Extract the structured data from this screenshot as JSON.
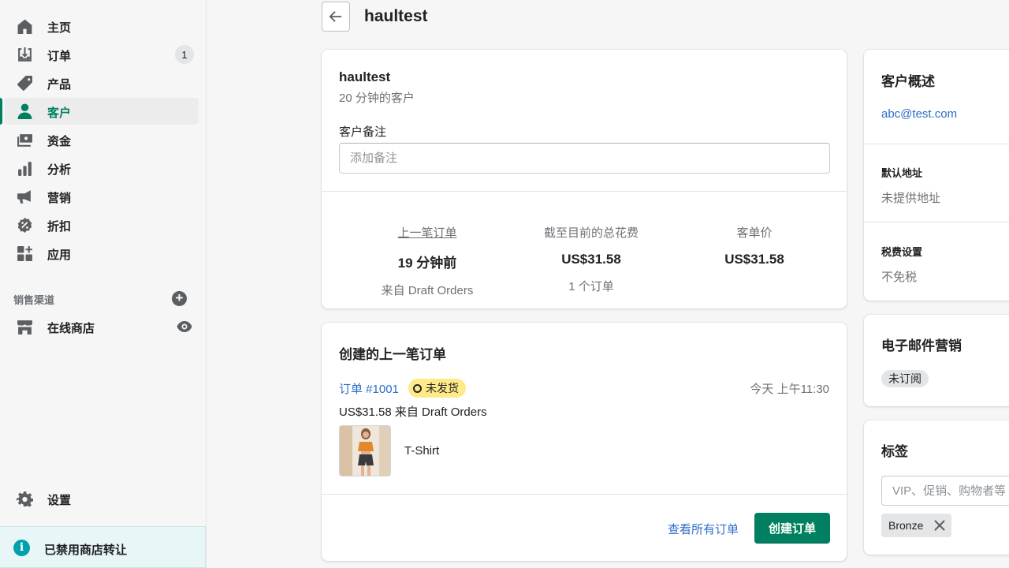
{
  "nav": {
    "items": [
      {
        "label": "主页",
        "icon": "home-icon"
      },
      {
        "label": "订单",
        "icon": "orders-icon",
        "badge": "1"
      },
      {
        "label": "产品",
        "icon": "tag-icon"
      },
      {
        "label": "客户",
        "icon": "person-icon",
        "active": true
      },
      {
        "label": "资金",
        "icon": "finances-icon"
      },
      {
        "label": "分析",
        "icon": "bar-chart-icon"
      },
      {
        "label": "营销",
        "icon": "megaphone-icon"
      },
      {
        "label": "折扣",
        "icon": "discount-icon"
      },
      {
        "label": "应用",
        "icon": "apps-icon"
      }
    ],
    "channels_title": "销售渠道",
    "online_store": "在线商店",
    "settings": "设置",
    "notice": "已禁用商店转让"
  },
  "header": {
    "title": "haultest"
  },
  "customer_card": {
    "name": "haultest",
    "since": "20 分钟的客户",
    "note_label": "客户备注",
    "note_placeholder": "添加备注",
    "stats": [
      {
        "head": "上一笔订单",
        "value": "19 分钟前",
        "sub": "来自 Draft Orders"
      },
      {
        "head": "截至目前的总花费",
        "value": "US$31.58",
        "sub": "1 个订单"
      },
      {
        "head": "客单价",
        "value": "US$31.58",
        "sub": ""
      }
    ]
  },
  "last_order": {
    "title": "创建的上一笔订单",
    "order_link": "订单 #1001",
    "status": "未发货",
    "time": "今天 上午11:30",
    "summary": "US$31.58 来自 Draft Orders",
    "product": "T-Shirt",
    "view_all": "查看所有订单",
    "create_order": "创建订单"
  },
  "overview": {
    "title": "客户概述",
    "email": "abc@test.com",
    "address_label": "默认地址",
    "address_value": "未提供地址",
    "tax_label": "税费设置",
    "tax_value": "不免税"
  },
  "email_marketing": {
    "title": "电子邮件营销",
    "status": "未订阅"
  },
  "tags": {
    "title": "标签",
    "placeholder": "VIP、促销、购物者等",
    "items": [
      "Bronze"
    ]
  },
  "colors": {
    "accent": "#008060",
    "link": "#2c6ecb",
    "unfulfilled_badge": "#ffea8a",
    "notice_bg": "#e9f6f7"
  }
}
